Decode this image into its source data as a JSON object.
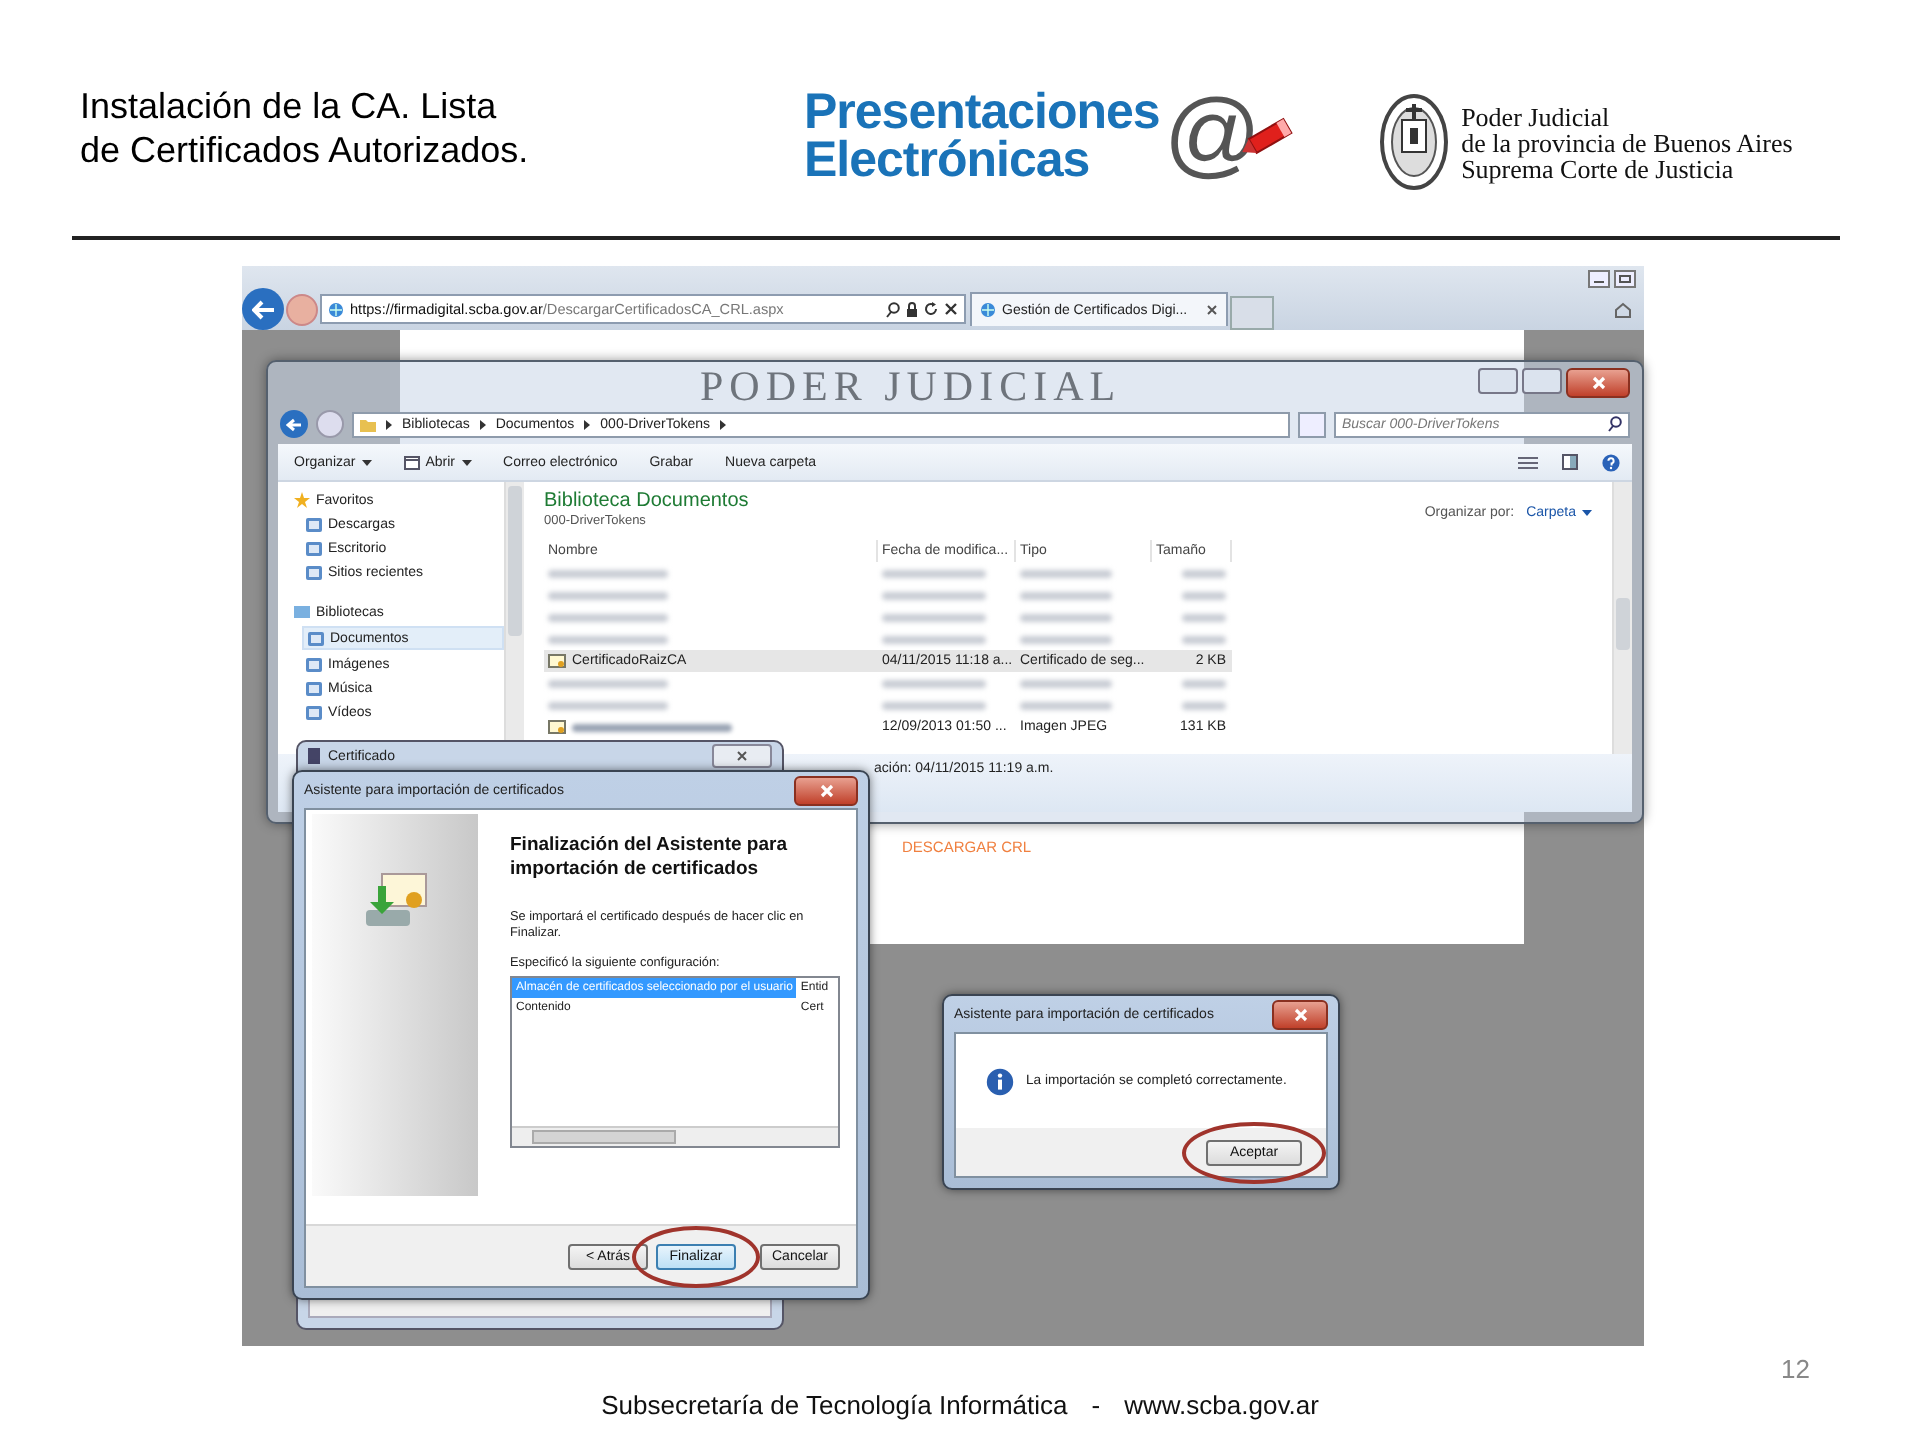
{
  "slide": {
    "title_lines": [
      "Instalación de la CA. Lista",
      "de Certificados Autorizados."
    ],
    "logo": {
      "line1": "Presentaciones",
      "line2": "Electrónicas",
      "symbol": "@"
    },
    "court": {
      "lines": [
        "Poder Judicial",
        "de la provincia de Buenos Aires",
        "Suprema Corte de Justicia"
      ]
    }
  },
  "browser": {
    "address_host": "https://firmadigital.scba.gov.ar",
    "address_path": "/DescargarCertificadosCA_CRL.aspx",
    "tab": "Gestión de Certificados Digi...",
    "page_banner": "PODER JUDICIAL",
    "page_link": "DESCARGAR CRL"
  },
  "explorer": {
    "breadcrumb": [
      "Bibliotecas",
      "Documentos",
      "000-DriverTokens"
    ],
    "search": {
      "placeholder": "Buscar 000-DriverTokens"
    },
    "toolbar": [
      {
        "label": "Organizar",
        "dropdown": true
      },
      {
        "label": "Abrir",
        "dropdown": true
      },
      {
        "label": "Correo electrónico",
        "dropdown": false
      },
      {
        "label": "Grabar",
        "dropdown": false
      },
      {
        "label": "Nueva carpeta",
        "dropdown": false
      }
    ],
    "nav": [
      {
        "label": "Favoritos",
        "selected": false,
        "children": [
          {
            "label": "Descargas",
            "selected": false
          },
          {
            "label": "Escritorio",
            "selected": false
          },
          {
            "label": "Sitios recientes",
            "selected": false
          }
        ]
      },
      {
        "label": "Bibliotecas",
        "selected": false,
        "children": [
          {
            "label": "Documentos",
            "selected": true
          },
          {
            "label": "Imágenes",
            "selected": false
          },
          {
            "label": "Música",
            "selected": false
          },
          {
            "label": "Vídeos",
            "selected": false
          }
        ]
      }
    ],
    "heading": "Biblioteca Documentos",
    "subheading": "000-DriverTokens",
    "arrange_label": "Organizar por:",
    "arrange_value": "Carpeta",
    "columns": [
      "Nombre",
      "Fecha de modifica...",
      "Tipo",
      "Tamaño"
    ],
    "rows": [
      {
        "kind": "blurred",
        "selected": false
      },
      {
        "kind": "blurred",
        "selected": false
      },
      {
        "kind": "blurred",
        "selected": false
      },
      {
        "kind": "blurred",
        "selected": false
      },
      {
        "kind": "file",
        "selected": true,
        "name": "CertificadoRaizCA",
        "date": "04/11/2015 11:18 a...",
        "type": "Certificado de seg...",
        "size": "2 KB"
      },
      {
        "kind": "blurred",
        "selected": false
      },
      {
        "kind": "blurred",
        "selected": false
      },
      {
        "kind": "partial",
        "selected": false,
        "date": "12/09/2013 01:50 ...",
        "type": "Imagen JPEG",
        "size": "131 KB"
      }
    ],
    "status": "ación: 04/11/2015 11:19 a.m."
  },
  "certificate_dialog": {
    "title": "Certificado"
  },
  "wizard": {
    "title": "Asistente para importación de certificados",
    "heading": "Finalización del Asistente para importación de certificados",
    "intro": "Se importará el certificado después de hacer clic en Finalizar.",
    "list_label": "Especificó la siguiente configuración:",
    "settings": [
      {
        "name": "Almacén de certificados seleccionado por el usuario",
        "value": "Entid",
        "selected": true
      },
      {
        "name": "Contenido",
        "value": "Cert",
        "selected": false
      }
    ],
    "buttons": [
      {
        "label": "< Atrás",
        "default": false,
        "circled": false
      },
      {
        "label": "Finalizar",
        "default": true,
        "circled": true
      },
      {
        "label": "Cancelar",
        "default": false,
        "circled": false
      }
    ]
  },
  "message_box": {
    "title": "Asistente para importación de certificados",
    "text": "La importación se completó correctamente.",
    "button": {
      "label": "Aceptar",
      "circled": true
    }
  },
  "footer": {
    "org": "Subsecretaría de Tecnología Informática",
    "separator": "-",
    "site": "www.scba.gov.ar",
    "page_number": "12"
  }
}
